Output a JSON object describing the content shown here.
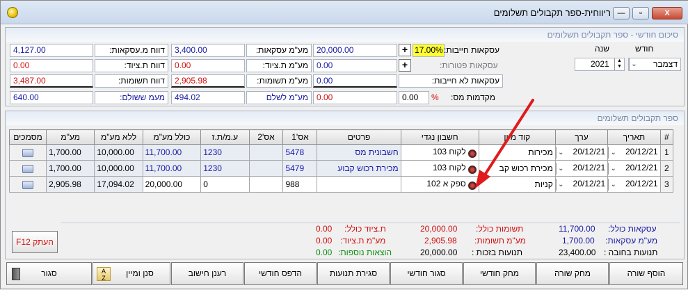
{
  "window": {
    "title": "ריווחית-ספר תקבולים תשלומים",
    "close": "X",
    "restore": "▫",
    "minimize": "—"
  },
  "monthly": {
    "header": "סיכום חודשי - ספר תקבולים תשלומים",
    "month_label": "חודש",
    "year_label": "שנה",
    "month_value": "דצמבר",
    "year_value": "2021",
    "rows": {
      "taxable_label": "עסקאות חייבות:",
      "taxable_rate": "17.00%",
      "taxable_value": "20,000.00",
      "exempt_label": "עסקאות פטורות:",
      "exempt_value": "0.00",
      "nontax_label": "עסקאות לא חייבות:",
      "nontax_value": "0.00",
      "advance_label": "מקדמות מס:",
      "advance_pct": "%",
      "advance_rate": "0.00",
      "advance_value": "0.00",
      "vat_deals_label": "מע\"מ עסקאות:",
      "vat_deals_value": "3,400.00",
      "vat_equip_label": "מע\"מ ת.ציוד:",
      "vat_equip_value": "0.00",
      "vat_inputs_label": "מע\"מ תשומות:",
      "vat_inputs_value": "2,905.98",
      "vat_pay_label": "מע\"מ לשלם",
      "vat_pay_value": "494.02",
      "rpt_deals_label": "דווח מ.עסקאות:",
      "rpt_deals_value": "4,127.00",
      "rpt_equip_label": "דווח ת.ציוד:",
      "rpt_equip_value": "0.00",
      "rpt_inputs_label": "דווח תשומות:",
      "rpt_inputs_value": "3,487.00",
      "paid_label": "מעמ ששולם:",
      "paid_value": "640.00"
    }
  },
  "book": {
    "header": "ספר תקבולים תשלומים",
    "columns": [
      "#",
      "תאריך",
      "ערך",
      "קוד מיון",
      "חשבון נגדי",
      "פרטים",
      "אס'1",
      "אס'2",
      "ע.מ/ת.ז",
      "כולל מע\"מ",
      "ללא מע\"מ",
      "מע\"מ",
      "מסמכים"
    ],
    "rows": [
      {
        "num": "1",
        "date": "20/12/21",
        "value": "20/12/21",
        "sort": "מכירות",
        "account": "לקוח 103",
        "details": "חשבונית מס",
        "ref1": "5478",
        "ref2": "",
        "tax_id": "1230",
        "total": "11,700.00",
        "net": "10,000.00",
        "vat": "1,700.00"
      },
      {
        "num": "2",
        "date": "20/12/21",
        "value": "20/12/21",
        "sort": "מכירת רכוש קב",
        "account": "לקוח 103",
        "details": "מכירת רכוש קבוע",
        "ref1": "5479",
        "ref2": "",
        "tax_id": "1230",
        "total": "11,700.00",
        "net": "10,000.00",
        "vat": "1,700.00"
      },
      {
        "num": "3",
        "date": "20/12/21",
        "value": "20/12/21",
        "sort": "קניות",
        "account": "ספק א 102",
        "details": "",
        "ref1": "988",
        "ref2": "",
        "tax_id": "0",
        "total": "20,000.00",
        "net": "17,094.02",
        "vat": "2,905.98"
      }
    ],
    "copy_btn": "העתק F12"
  },
  "summary": {
    "total_deals_label": "עסקאות כולל:",
    "total_deals": "11,700.00",
    "vat_deals_label": "מע\"מ עסקאות:",
    "vat_deals": "1,700.00",
    "debit_label": "תנועות בחובה :",
    "debit": "23,400.00",
    "total_inputs_label": "תשומות כולל:",
    "total_inputs": "20,000.00",
    "vat_inputs_label": "מע\"מ תשומות:",
    "vat_inputs": "2,905.98",
    "credit_label": "תנועות בזכות :",
    "credit": "20,000.00",
    "equip_total_label": "ת.ציוד כולל:",
    "equip_total": "0.00",
    "vat_equip_label": "מע\"מ ת.ציוד:",
    "vat_equip": "0.00",
    "extra_label": "הוצאות נוספות:",
    "extra": "0.00"
  },
  "buttons": {
    "add_row": "הוסף שורה",
    "delete_row": "מחק שורה",
    "delete_month": "מחק חודשי",
    "close_month": "סגור חודשי",
    "close_moves": "סגירת תנועות",
    "print_month": "הדפס חודשי",
    "recalc": "רענן חישוב",
    "filter_sort": "סנן ומיין",
    "close": "סגור"
  },
  "colors": {
    "blue": "#1a1aa6",
    "red": "#d11010",
    "green": "#0a8a0a",
    "highlight": "#ffff33"
  }
}
